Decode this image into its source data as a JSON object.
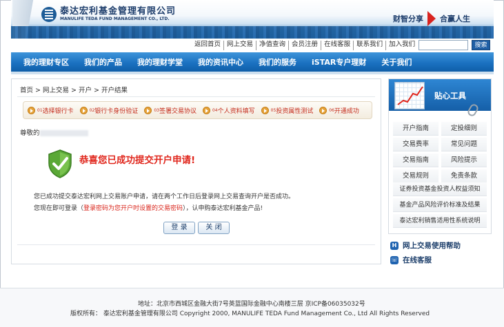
{
  "header": {
    "logo_cn": "泰达宏利基金管理有限公司",
    "logo_en": "MANULIFE TEDA FUND MANAGEMENT CO., LTD.",
    "slogan_left": "财智分享",
    "slogan_right": "合赢人生"
  },
  "toplinks": [
    "返回首页",
    "网上交易",
    "净值查询",
    "会员注册",
    "在线客服",
    "联系我们",
    "加入我们"
  ],
  "search": {
    "button": "搜索",
    "value": ""
  },
  "nav": [
    "我的理财专区",
    "我们的产品",
    "我的理财学堂",
    "我的资讯中心",
    "我们的服务",
    "iSTAR专户理财",
    "关于我们"
  ],
  "breadcrumb": "首页  > 网上交易  > 开户  > 开户结果",
  "steps": [
    {
      "num": "01",
      "label": "选择银行卡"
    },
    {
      "num": "02",
      "label": "银行卡身份验证"
    },
    {
      "num": "03",
      "label": "签署交易协议"
    },
    {
      "num": "04",
      "label": "个人资料填写"
    },
    {
      "num": "05",
      "label": "投资属性测试"
    },
    {
      "num": "06",
      "label": "开通成功"
    }
  ],
  "greeting": "尊敬的",
  "success_title": "恭喜您已成功提交开户申请!",
  "message1": "您已成功提交泰达宏利网上交易账户申请，请在两个工作日后登录网上交易查询开户是否成功。",
  "message2_pre": "您现在即可登录（",
  "message2_red": "登录密码为您开户时设置的交易密码",
  "message2_post": "），认申购泰达宏利基金产品!",
  "buttons": {
    "login": "登 录",
    "close": "关 闭"
  },
  "sidebar": {
    "title": "贴心工具",
    "grid": [
      "开户指南",
      "定投细则",
      "交易费率",
      "常见问题",
      "交易指南",
      "风险提示",
      "交易规则",
      "免责条款"
    ],
    "wide": [
      "证券投资基金投资人权益须知",
      "基金产品风险评价标准及结果",
      "泰达宏利销售适用性系统说明"
    ],
    "help": [
      "网上交易使用帮助",
      "在线客服"
    ]
  },
  "footer": {
    "address": "地址：北京市西城区金融大街7号英蓝国际金融中心南楼三层  京ICP备06035032号",
    "copyright": "版权所有：   泰达宏利基金管理有限公司  Copyright 2000, MANULIFE TEDA Fund Management Co., Ltd All Rights Reserved"
  },
  "colors": {
    "nav_blue": "#1b72c1",
    "accent_red": "#e0261c",
    "step_red": "#c42c1c"
  }
}
